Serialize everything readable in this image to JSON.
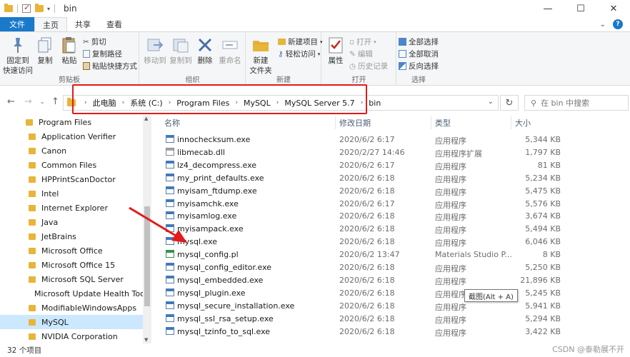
{
  "window": {
    "title": "bin",
    "controls": [
      "—",
      "☐",
      "✕"
    ]
  },
  "ribbon_tabs": [
    {
      "label": "文件"
    },
    {
      "label": "主页"
    },
    {
      "label": "共享"
    },
    {
      "label": "查看"
    }
  ],
  "ribbon": {
    "pin_label": "固定到\n快速访问",
    "copy_label": "复制",
    "paste_label": "粘贴",
    "cut_label": "剪切",
    "copy_path_label": "复制路径",
    "paste_shortcut_label": "粘贴快捷方式",
    "clipboard_group": "剪贴板",
    "move_to_label": "移动到",
    "copy_to_label": "复制到",
    "delete_label": "删除",
    "rename_label": "重命名",
    "organize_group": "组织",
    "new_folder_label": "新建\n文件夹",
    "new_item_label": "新建项目",
    "easy_access_label": "轻松访问",
    "new_group": "新建",
    "properties_label": "属性",
    "open_label": "打开",
    "edit_label": "编辑",
    "history_label": "历史记录",
    "open_group": "打开",
    "select_all_label": "全部选择",
    "select_none_label": "全部取消",
    "invert_label": "反向选择",
    "select_group": "选择"
  },
  "address": {
    "crumbs": [
      "此电脑",
      "系统 (C:)",
      "Program Files",
      "MySQL",
      "MySQL Server 5.7",
      "bin"
    ],
    "search_placeholder": "在 bin 中搜索"
  },
  "tree": {
    "items": [
      {
        "label": "Program Files",
        "selected": false
      },
      {
        "label": "Application Verifier",
        "selected": false
      },
      {
        "label": "Canon",
        "selected": false
      },
      {
        "label": "Common Files",
        "selected": false
      },
      {
        "label": "HPPrintScanDoctor",
        "selected": false
      },
      {
        "label": "Intel",
        "selected": false
      },
      {
        "label": "Internet Explorer",
        "selected": false
      },
      {
        "label": "Java",
        "selected": false
      },
      {
        "label": "JetBrains",
        "selected": false
      },
      {
        "label": "Microsoft Office",
        "selected": false
      },
      {
        "label": "Microsoft Office 15",
        "selected": false
      },
      {
        "label": "Microsoft SQL Server",
        "selected": false
      },
      {
        "label": "Microsoft Update Health Tools",
        "selected": false
      },
      {
        "label": "ModifiableWindowsApps",
        "selected": false
      },
      {
        "label": "MySQL",
        "selected": true
      },
      {
        "label": "NVIDIA Corporation",
        "selected": false
      }
    ]
  },
  "columns": {
    "name": "名称",
    "date": "修改日期",
    "type": "类型",
    "size": "大小"
  },
  "files": [
    {
      "name": "innochecksum.exe",
      "date": "2020/6/2 6:17",
      "type": "应用程序",
      "size": "5,344 KB",
      "icon": "exe"
    },
    {
      "name": "libmecab.dll",
      "date": "2020/2/27 14:46",
      "type": "应用程序扩展",
      "size": "1,797 KB",
      "icon": "dll"
    },
    {
      "name": "lz4_decompress.exe",
      "date": "2020/6/2 6:17",
      "type": "应用程序",
      "size": "81 KB",
      "icon": "exe"
    },
    {
      "name": "my_print_defaults.exe",
      "date": "2020/6/2 6:18",
      "type": "应用程序",
      "size": "5,234 KB",
      "icon": "exe"
    },
    {
      "name": "myisam_ftdump.exe",
      "date": "2020/6/2 6:18",
      "type": "应用程序",
      "size": "5,475 KB",
      "icon": "exe"
    },
    {
      "name": "myisamchk.exe",
      "date": "2020/6/2 6:17",
      "type": "应用程序",
      "size": "5,576 KB",
      "icon": "exe"
    },
    {
      "name": "myisamlog.exe",
      "date": "2020/6/2 6:18",
      "type": "应用程序",
      "size": "3,674 KB",
      "icon": "exe"
    },
    {
      "name": "myisampack.exe",
      "date": "2020/6/2 6:18",
      "type": "应用程序",
      "size": "5,494 KB",
      "icon": "exe"
    },
    {
      "name": "mysql.exe",
      "date": "2020/6/2 6:18",
      "type": "应用程序",
      "size": "6,046 KB",
      "icon": "exe"
    },
    {
      "name": "mysql_config.pl",
      "date": "2020/6/2 13:47",
      "type": "Materials Studio P...",
      "size": "8 KB",
      "icon": "pl"
    },
    {
      "name": "mysql_config_editor.exe",
      "date": "2020/6/2 6:18",
      "type": "应用程序",
      "size": "5,250 KB",
      "icon": "exe"
    },
    {
      "name": "mysql_embedded.exe",
      "date": "2020/6/2 6:18",
      "type": "应用程序",
      "size": "21,896 KB",
      "icon": "exe"
    },
    {
      "name": "mysql_plugin.exe",
      "date": "2020/6/2 6:18",
      "type": "应用程序",
      "size": "5,245 KB",
      "icon": "exe"
    },
    {
      "name": "mysql_secure_installation.exe",
      "date": "2020/6/2 6:18",
      "type": "应用程序",
      "size": "5,941 KB",
      "icon": "exe"
    },
    {
      "name": "mysql_ssl_rsa_setup.exe",
      "date": "2020/6/2 6:18",
      "type": "应用程序",
      "size": "5,294 KB",
      "icon": "exe"
    },
    {
      "name": "mysql_tzinfo_to_sql.exe",
      "date": "2020/6/2 6:18",
      "type": "应用程序",
      "size": "3,422 KB",
      "icon": "exe"
    }
  ],
  "tooltip": "截图(Alt + A)",
  "status": {
    "count": "32 个项目"
  },
  "watermark": "CSDN @泰勒展不开",
  "colors": {
    "accent": "#1979ca",
    "highlight": "#e21b1b",
    "selected": "#cce8ff"
  }
}
